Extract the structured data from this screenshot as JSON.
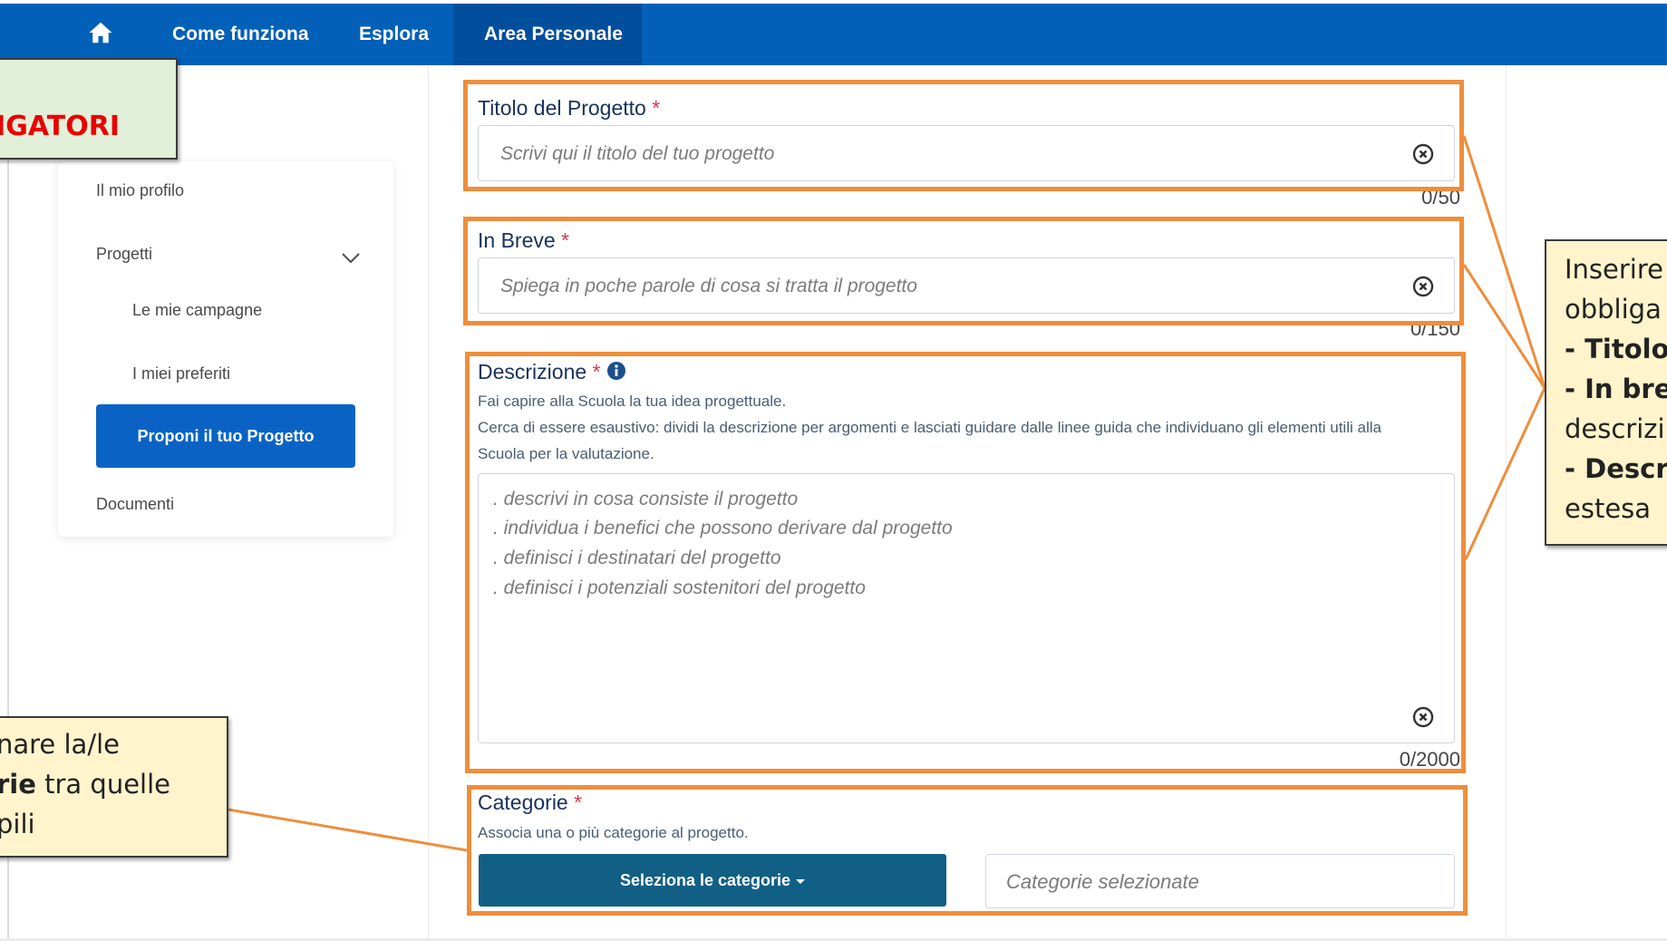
{
  "nav": {
    "items": [
      {
        "label": "Come funziona"
      },
      {
        "label": "Esplora"
      },
      {
        "label": "Area Personale"
      }
    ]
  },
  "sidebar": {
    "profile": "Il mio profilo",
    "projects": "Progetti",
    "campaigns": "Le mie campagne",
    "favorites": "I miei preferiti",
    "propose": "Proponi il tuo Progetto",
    "documents": "Documenti"
  },
  "form": {
    "title": {
      "label": "Titolo del Progetto",
      "required_mark": "*",
      "placeholder": "Scrivi qui il titolo del tuo progetto",
      "counter": "0/50"
    },
    "summary": {
      "label": "In Breve",
      "required_mark": "*",
      "placeholder": "Spiega in poche parole di cosa si tratta il progetto",
      "counter": "0/150"
    },
    "description": {
      "label": "Descrizione",
      "required_mark": "*",
      "help_1": "Fai capire alla Scuola la tua idea progettuale.",
      "help_2": "Cerca di essere esaustivo: dividi la descrizione per argomenti e lasciati guidare dalle linee guida che individuano gli elementi utili alla",
      "help_3": "Scuola per la valutazione.",
      "placeholder_lines": [
        ". descrivi in cosa consiste il progetto",
        ". individua i benefici che possono derivare dal progetto",
        ". definisci i destinatari del progetto",
        ". definisci i potenziali sostenitori del progetto"
      ],
      "counter": "0/2000"
    },
    "categories": {
      "label": "Categorie",
      "required_mark": "*",
      "help": "Associa una o più categorie al progetto.",
      "button": "Seleziona le categorie",
      "selected_placeholder": "Categorie selezionate"
    }
  },
  "annotations": {
    "top_left": "IGATORI",
    "right_lines": [
      "Inserire",
      "obbliga",
      "- Titolo",
      "- In bre",
      "descrizi",
      "- Descr",
      "estesa"
    ],
    "left_line_1": "nare la/le",
    "left_line_2_bold": "rie",
    "left_line_2_rest": " tra quelle",
    "left_line_3": "pili"
  },
  "colors": {
    "nav_bg": "#0260b8",
    "nav_active_bg": "#014e9c",
    "primary_button": "#0a63c4",
    "category_button": "#115f85",
    "label_text": "#17325c",
    "required": "#d9364f",
    "highlight_orange": "#ee8e3c",
    "note_green_bg": "#e2efd9",
    "note_yellow_bg": "#fff4cc",
    "note_red_text": "#ea0000"
  },
  "icons": [
    "home-icon",
    "chevron-down-icon",
    "clear-icon",
    "info-icon",
    "caret-down-icon"
  ]
}
